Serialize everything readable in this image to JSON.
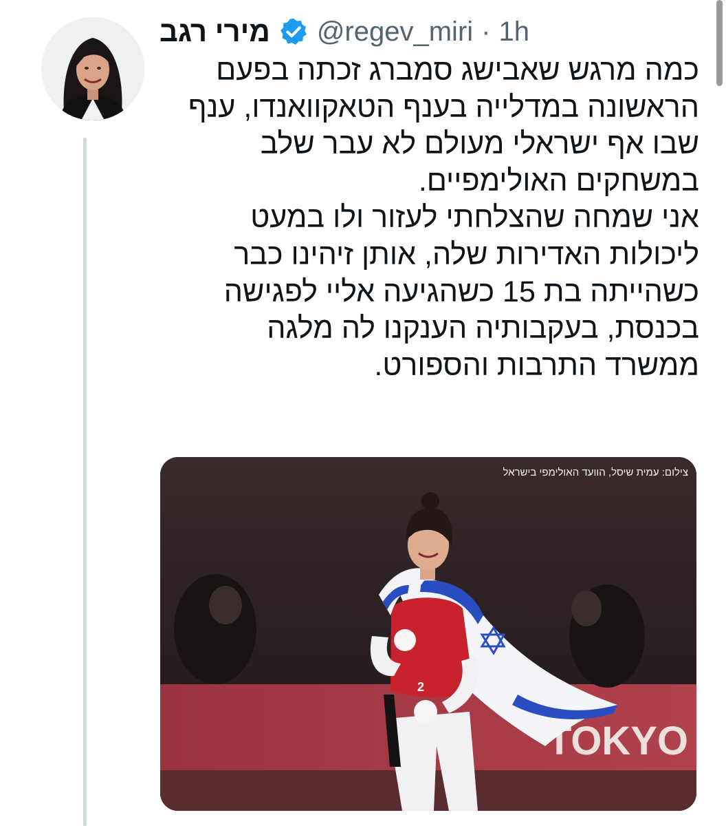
{
  "tweet": {
    "author_name": "מירי רגב",
    "handle": "@regev_miri",
    "separator": "·",
    "time": "1h",
    "lines": [
      "כמה מרגש שאבישג סמברג זכתה בפעם",
      "הראשונה במדלייה בענף הטאקוואנדו, ענף",
      "שבו אף ישראלי מעולם לא עבר שלב",
      "במשחקים האולימפיים.",
      "אני שמחה שהצלחתי לעזור ולו במעט",
      "ליכולות האדירות שלה, אותן זיהינו כבר",
      "כשהייתה בת 15 כשהגיעה אליי לפגישה",
      "בכנסת, בעקבותיה הענקנו לה מלגה",
      "ממשרד התרבות והספורט."
    ]
  },
  "media": {
    "photo_credit": "צילום: עמית שיסל, הוועד האולימפי בישראל",
    "signage_text": "TOKYO",
    "bib_number": "2"
  },
  "colors": {
    "verified_blue": "#1d9bf0",
    "thread_line": "#cfd9de",
    "secondary_text": "#536471",
    "flag_blue": "#2a4ec2",
    "dobok_red": "#c8232c"
  }
}
